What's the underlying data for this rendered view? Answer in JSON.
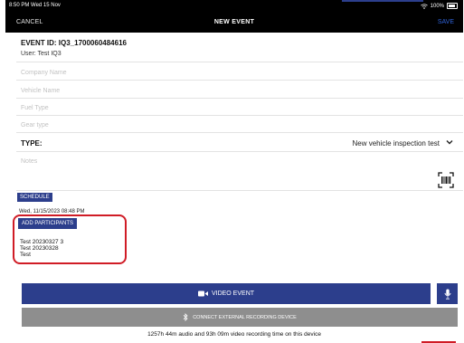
{
  "status_bar": {
    "time": "8:50 PM  Wed 15 Nov",
    "battery": "100%"
  },
  "nav": {
    "cancel": "CANCEL",
    "title": "NEW EVENT",
    "save": "SAVE"
  },
  "event": {
    "id_line": "EVENT ID: IQ3_1700060484616",
    "user_line": "User: Test IQ3"
  },
  "fields": {
    "company_placeholder": "Company Name",
    "vehicle_placeholder": "Vehicle Name",
    "fuel_placeholder": "Fuel Type",
    "gear_placeholder": "Gear type"
  },
  "type": {
    "label": "TYPE:",
    "value": "New vehicle inspection test"
  },
  "notes": {
    "placeholder": "Notes"
  },
  "schedule": {
    "button": "SCHEDULE",
    "date": "Wed, 11/15/2023 08:48 PM"
  },
  "participants": {
    "button": "ADD PARTICIPANTS",
    "items": [
      "Test 20230327 3",
      "Test 20230328",
      "Test"
    ]
  },
  "video": {
    "label": "VIDEO EVENT"
  },
  "connect": {
    "label": "CONNECT EXTERNAL RECORDING DEVICE"
  },
  "recording_time": "1257h 44m audio and 93h 09m video recording time on this device",
  "colors": {
    "accent": "#2c3e8c",
    "highlight": "#d01c26",
    "save": "#2f62d8",
    "connect": "#8e8e8e"
  },
  "icons": [
    "wifi-icon",
    "battery-icon",
    "chevron-down-icon",
    "barcode-scan-icon",
    "video-camera-icon",
    "microphone-icon",
    "bluetooth-icon"
  ]
}
